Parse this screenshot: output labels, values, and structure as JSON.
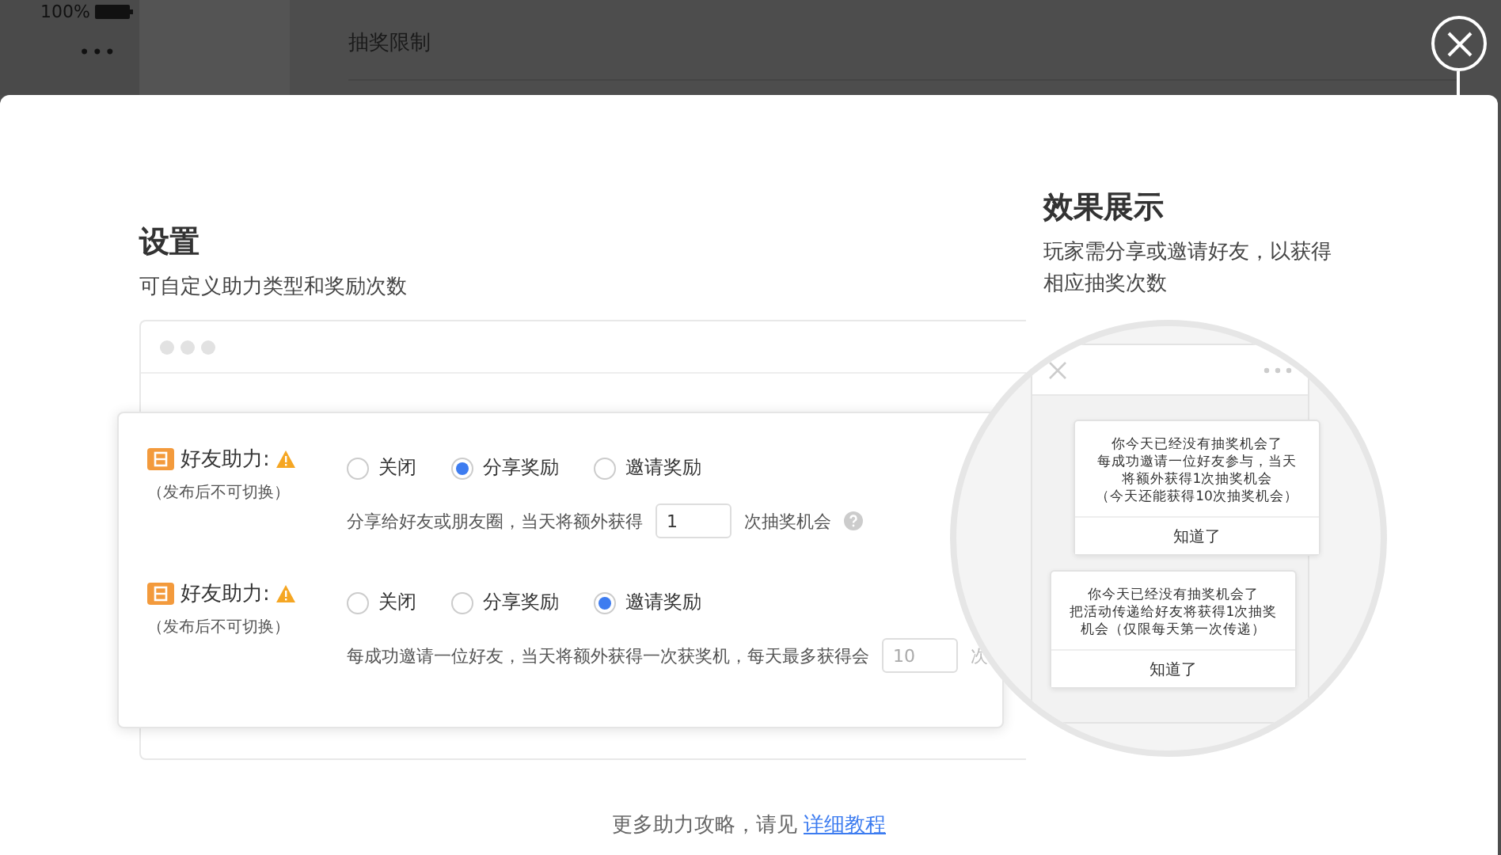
{
  "backdrop": {
    "battery": "100%",
    "more": "•••",
    "section_title": "抽奖限制"
  },
  "settings": {
    "title": "设置",
    "subtitle": "可自定义助力类型和奖励次数",
    "rows": [
      {
        "label": "好友助力:",
        "note": "（发布后不可切换）",
        "options": [
          {
            "label": "关闭",
            "selected": false
          },
          {
            "label": "分享奖励",
            "selected": true
          },
          {
            "label": "邀请奖励",
            "selected": false
          }
        ],
        "hint_before": "分享给好友或朋友圈，当天将额外获得",
        "input": {
          "value": "1",
          "disabled": false
        },
        "hint_after": "次抽奖机会",
        "help": true
      },
      {
        "label": "好友助力:",
        "note": "（发布后不可切换）",
        "options": [
          {
            "label": "关闭",
            "selected": false
          },
          {
            "label": "分享奖励",
            "selected": false
          },
          {
            "label": "邀请奖励",
            "selected": true
          }
        ],
        "hint_before": "每成功邀请一位好友，当天将额外获得一次获奖机，每天最多获得会",
        "input": {
          "value": "10",
          "disabled": true
        },
        "hint_after": "次",
        "help": false
      }
    ]
  },
  "preview": {
    "title": "效果展示",
    "description": "玩家需分享或邀请好友，以获得相应抽奖次数",
    "popups": [
      {
        "lines": [
          "你今天已经没有抽奖机会了",
          "每成功邀请一位好友参与，当天",
          "将额外获得1次抽奖机会",
          "（今天还能获得10次抽奖机会）"
        ],
        "button": "知道了"
      },
      {
        "lines": [
          "你今天已经没有抽奖机会了",
          "把活动传递给好友将获得1次抽奖",
          "机会（仅限每天第一次传递）"
        ],
        "button": "知道了"
      }
    ]
  },
  "footer": {
    "text": "更多助力攻略，请见",
    "link": "详细教程"
  }
}
